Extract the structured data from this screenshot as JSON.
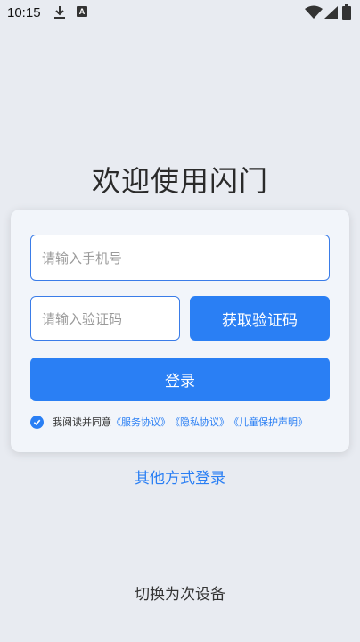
{
  "status_bar": {
    "time": "10:15",
    "icons": [
      "download-icon",
      "a-notification-icon",
      "wifi-icon",
      "signal-icon",
      "battery-icon"
    ],
    "notification_letter": "A"
  },
  "title": "欢迎使用闪门",
  "form": {
    "phone_placeholder": "请输入手机号",
    "code_placeholder": "请输入验证码",
    "get_code_label": "获取验证码",
    "login_label": "登录",
    "agreement": {
      "checked": true,
      "prefix": "我阅读并同意",
      "links": [
        "《服务协议》",
        "《隐私协议》",
        "《儿童保护声明》"
      ]
    }
  },
  "other_login_label": "其他方式登录",
  "switch_device_label": "切换为次设备",
  "colors": {
    "accent": "#2a7ff4",
    "background": "#e8ebf1",
    "card": "#f2f5fa"
  }
}
